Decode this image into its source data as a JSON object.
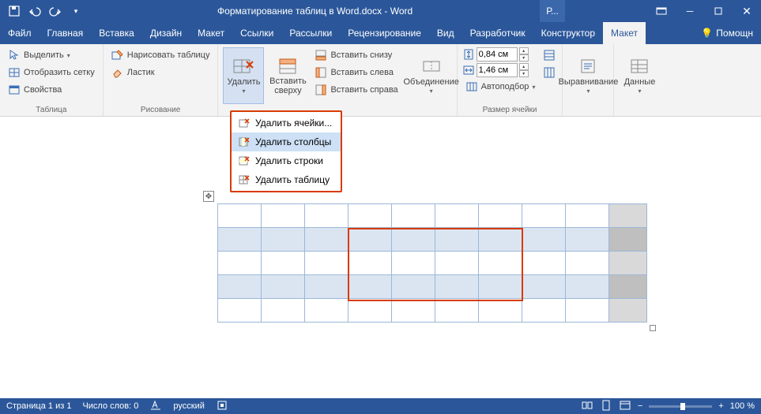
{
  "titlebar": {
    "doc_title": "Форматирование таблиц в Word.docx - Word",
    "p_label": "Р..."
  },
  "tabs": {
    "file": "Файл",
    "home": "Главная",
    "insert": "Вставка",
    "design": "Дизайн",
    "layout": "Макет",
    "references": "Ссылки",
    "mailings": "Рассылки",
    "review": "Рецензирование",
    "view": "Вид",
    "developer": "Разработчик",
    "constructor": "Конструктор",
    "table_layout": "Макет",
    "help": "Помощн"
  },
  "ribbon": {
    "table": {
      "label": "Таблица",
      "select": "Выделить",
      "gridlines": "Отобразить сетку",
      "properties": "Свойства"
    },
    "draw": {
      "label": "Рисование",
      "draw_table": "Нарисовать таблицу",
      "eraser": "Ластик"
    },
    "rowscols": {
      "delete": "Удалить",
      "insert_above": "Вставить сверху",
      "insert_below": "Вставить снизу",
      "insert_left": "Вставить слева",
      "insert_right": "Вставить справа"
    },
    "merge": {
      "label": "Объединение"
    },
    "cellsize": {
      "label": "Размер ячейки",
      "height": "0,84 см",
      "width": "1,46 см",
      "autofit": "Автоподбор"
    },
    "align": {
      "label": "Выравнивание"
    },
    "data": {
      "label": "Данные"
    }
  },
  "dropdown": {
    "del_cells": "Удалить ячейки...",
    "del_cols": "Удалить столбцы",
    "del_rows": "Удалить строки",
    "del_table": "Удалить таблицу"
  },
  "status": {
    "page": "Страница 1 из 1",
    "words": "Число слов: 0",
    "lang": "русский",
    "zoom": "100 %"
  }
}
